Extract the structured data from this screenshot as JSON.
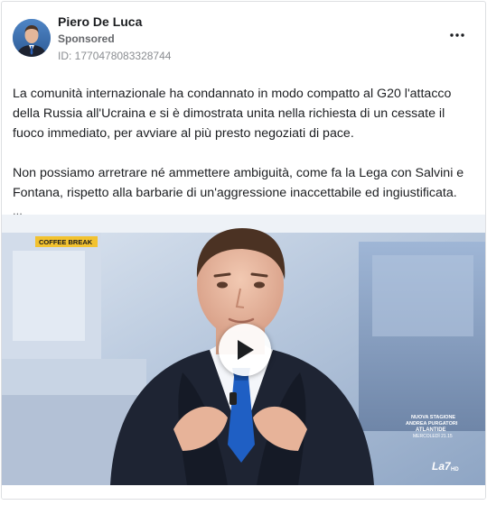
{
  "post": {
    "author": "Piero De Luca",
    "sponsored": "Sponsored",
    "ad_id": "ID: 1770478083328744",
    "more_icon": "three-dots-icon",
    "body": {
      "paragraph_1": "La comunità internazionale ha condannato in modo compatto al G20 l'attacco della Russia all'Ucraina e si è dimostrata unita nella richiesta di un cessate il fuoco immediato, per avviare al più presto negoziati di pace.",
      "paragraph_2": "Non possiamo arretrare né ammettere ambiguità, come fa la Lega con Salvini e Fontana, rispetto alla barbarie di un'aggressione inaccettabile ed ingiustificata.",
      "see_more": "..."
    },
    "video": {
      "show_badge": "COFFEE BREAK",
      "promo_line_1": "NUOVA STAGIONE",
      "promo_line_2": "ANDREA PURGATORI",
      "promo_line_3": "ATLANTIDE",
      "promo_line_4": "MERCOLEDÌ 21.15",
      "channel_logo": "La7",
      "channel_hd": "HD",
      "play_icon": "play-icon"
    }
  },
  "colors": {
    "text": "#1c1e21",
    "secondary": "#65676b",
    "badge_bg": "#f2c230",
    "suit": "#1e2433",
    "tie": "#1f5fc4"
  }
}
